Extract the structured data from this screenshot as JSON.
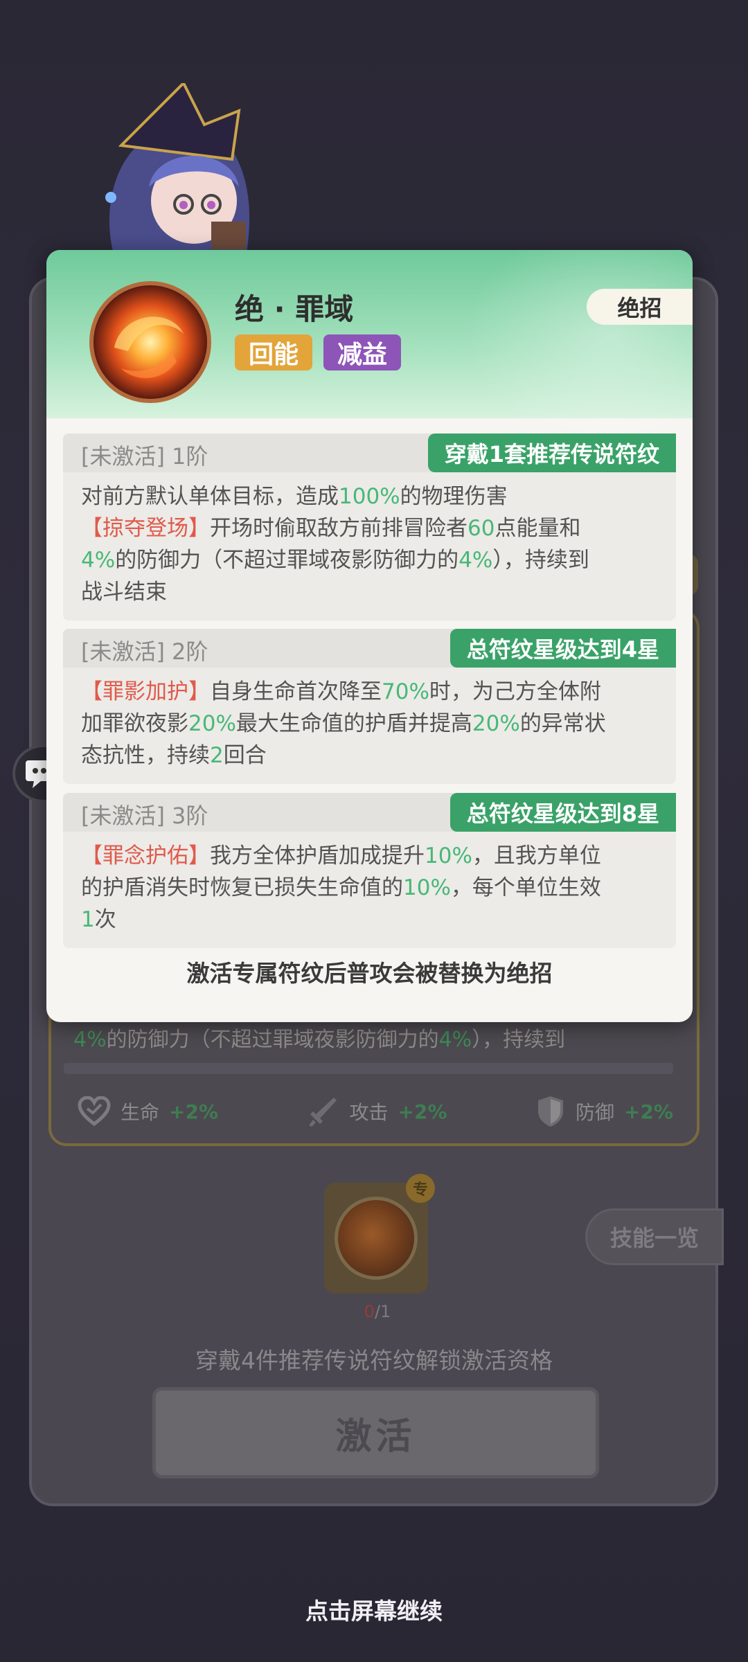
{
  "popup": {
    "title": "绝 · 罪域",
    "tags": [
      "回能",
      "减益"
    ],
    "type_label": "绝招",
    "tiers": [
      {
        "status": "[未激活]",
        "level": "1阶",
        "requirement": "穿戴1套推荐传说符纹",
        "desc": [
          {
            "t": "对前方默认单体目标，造成",
            "c": ""
          },
          {
            "t": "100%",
            "c": "g"
          },
          {
            "t": "的物理伤害",
            "c": ""
          },
          {
            "t": "br",
            "c": "br"
          },
          {
            "t": "【掠夺登场】",
            "c": "red"
          },
          {
            "t": "开场时偷取敌方前排冒险者",
            "c": ""
          },
          {
            "t": "60",
            "c": "g"
          },
          {
            "t": "点能量和",
            "c": ""
          },
          {
            "t": "br",
            "c": "br"
          },
          {
            "t": "4%",
            "c": "g"
          },
          {
            "t": "的防御力（不超过罪域夜影防御力的",
            "c": ""
          },
          {
            "t": "4%",
            "c": "g"
          },
          {
            "t": "），持续到",
            "c": ""
          },
          {
            "t": "br",
            "c": "br"
          },
          {
            "t": "战斗结束",
            "c": ""
          }
        ]
      },
      {
        "status": "[未激活]",
        "level": "2阶",
        "requirement": "总符纹星级达到4星",
        "desc": [
          {
            "t": "【罪影加护】",
            "c": "red"
          },
          {
            "t": "自身生命首次降至",
            "c": ""
          },
          {
            "t": "70%",
            "c": "g"
          },
          {
            "t": "时，为己方全体附",
            "c": ""
          },
          {
            "t": "br",
            "c": "br"
          },
          {
            "t": "加罪欲夜影",
            "c": ""
          },
          {
            "t": "20%",
            "c": "g"
          },
          {
            "t": "最大生命值的护盾并提高",
            "c": ""
          },
          {
            "t": "20%",
            "c": "g"
          },
          {
            "t": "的异常状",
            "c": ""
          },
          {
            "t": "br",
            "c": "br"
          },
          {
            "t": "态抗性，持续",
            "c": ""
          },
          {
            "t": "2",
            "c": "g"
          },
          {
            "t": "回合",
            "c": ""
          }
        ]
      },
      {
        "status": "[未激活]",
        "level": "3阶",
        "requirement": "总符纹星级达到8星",
        "desc": [
          {
            "t": "【罪念护佑】",
            "c": "red"
          },
          {
            "t": "我方全体护盾加成提升",
            "c": ""
          },
          {
            "t": "10%",
            "c": "g"
          },
          {
            "t": "，且我方单位",
            "c": ""
          },
          {
            "t": "br",
            "c": "br"
          },
          {
            "t": "的护盾消失时恢复已损失生命值的",
            "c": ""
          },
          {
            "t": "10%",
            "c": "g"
          },
          {
            "t": "，每个单位生效",
            "c": ""
          },
          {
            "t": "br",
            "c": "br"
          },
          {
            "t": "1",
            "c": "g"
          },
          {
            "t": "次",
            "c": ""
          }
        ]
      }
    ],
    "footer": "激活专属符纹后普攻会被替换为绝招"
  },
  "background": {
    "desc_line": [
      {
        "t": "4%",
        "c": "g"
      },
      {
        "t": "的防御力（不超过罪域夜影防御力的",
        "c": ""
      },
      {
        "t": "4%",
        "c": "g"
      },
      {
        "t": "），持续到",
        "c": ""
      }
    ],
    "stats": [
      {
        "icon": "heart-icon",
        "label": "生命",
        "value": "+2%"
      },
      {
        "icon": "sword-icon",
        "label": "攻击",
        "value": "+2%"
      },
      {
        "icon": "shield-icon",
        "label": "防御",
        "value": "+2%"
      }
    ],
    "rune_count_current": "0",
    "rune_count_total": "/1",
    "rune_badge": "专",
    "skill_list_label": "技能一览",
    "unlock_hint": "穿戴4件推荐传说符纹解锁激活资格",
    "activate_label": "激活"
  },
  "continue_hint": "点击屏幕继续",
  "colors": {
    "header_green": "#6fca9a",
    "requirement_green": "#3aa268",
    "highlight_green": "#47b877",
    "highlight_red": "#e05a4c",
    "tag_energy": "#e3a43a",
    "tag_debuff": "#8d55b8"
  }
}
